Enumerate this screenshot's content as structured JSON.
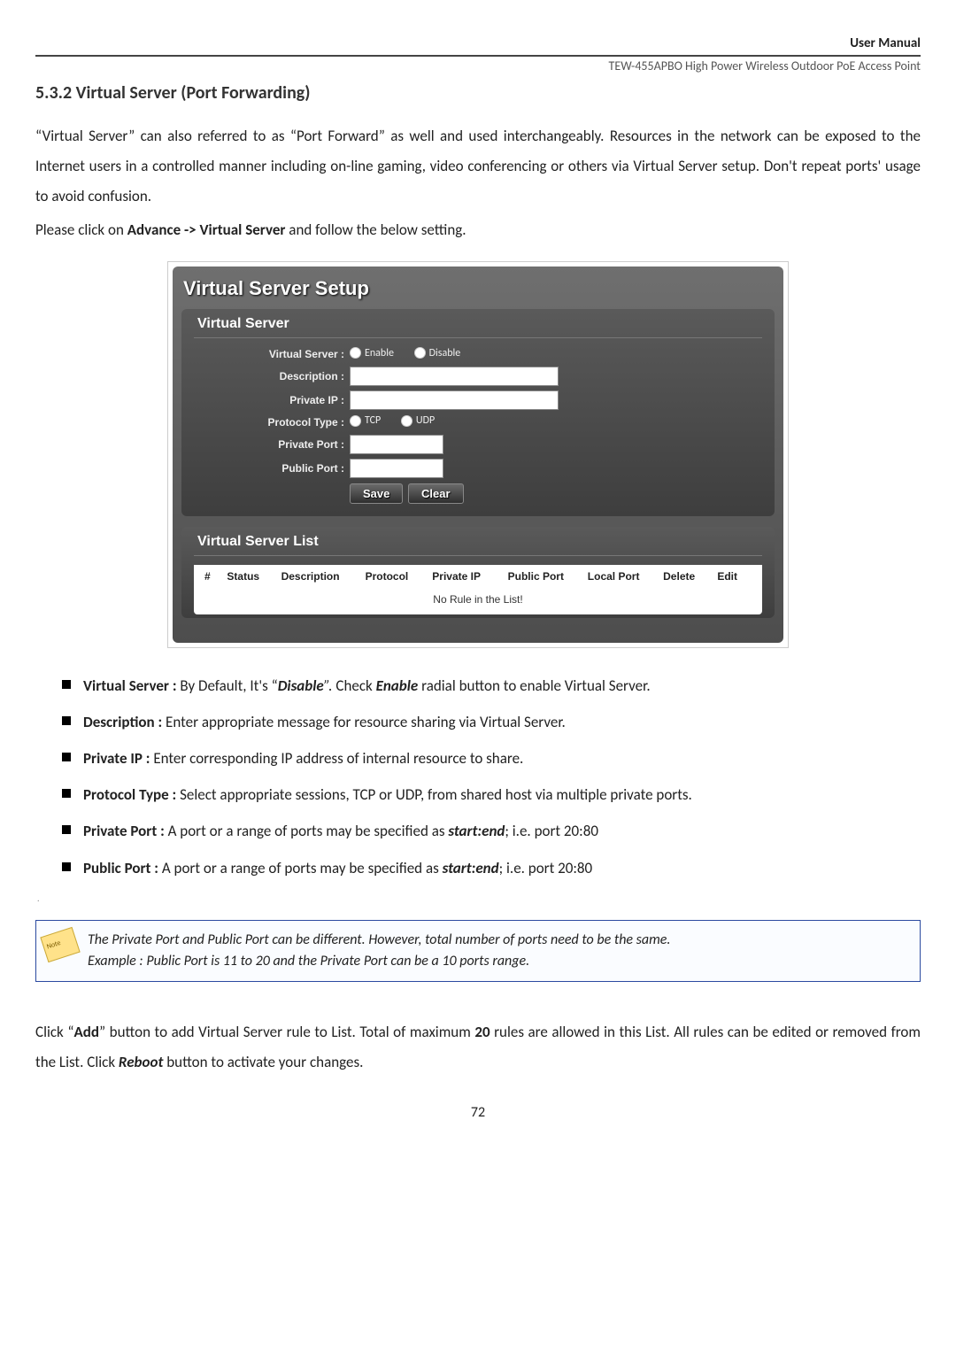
{
  "header": {
    "user_manual": "User Manual",
    "device": "TEW-455APBO High Power Wireless Outdoor PoE Access Point"
  },
  "section": {
    "heading": "5.3.2 Virtual Server (Port Forwarding)",
    "para1": "“Virtual Server” can also referred to as “Port Forward” as well and used interchangeably. Resources in the network can be exposed to the Internet users in a controlled manner including on-line gaming, video conferencing or others via Virtual Server setup.  Don't repeat ports' usage to avoid confusion.",
    "para2_pre": "Please click on ",
    "para2_bold": "Advance -> Virtual Server",
    "para2_post": " and follow the below setting."
  },
  "shot": {
    "title": "Virtual Server Setup",
    "panel1": {
      "header": "Virtual Server",
      "labels": {
        "vs": "Virtual Server :",
        "desc": "Description :",
        "pip": "Private IP :",
        "ptype": "Protocol Type :",
        "pport": "Private Port :",
        "pubport": "Public Port :"
      },
      "radios": {
        "enable": "Enable",
        "disable": "Disable",
        "tcp": "TCP",
        "udp": "UDP"
      },
      "buttons": {
        "save": "Save",
        "clear": "Clear"
      }
    },
    "panel2": {
      "header": "Virtual Server List",
      "cols": {
        "hash": "#",
        "status": "Status",
        "desc": "Description",
        "proto": "Protocol",
        "pip": "Private IP",
        "pubport": "Public Port",
        "lport": "Local Port",
        "del": "Delete",
        "edit": "Edit"
      },
      "empty": "No Rule in the List!"
    }
  },
  "bullets": {
    "b1_label": "Virtual Server : ",
    "b1_t1": "By Default, It's “",
    "b1_em1": "Disable",
    "b1_t2": "”. ",
    "b1_t3": "Check ",
    "b1_em2": "Enable",
    "b1_t4": " radial button to enable Virtual Server.",
    "b2_label": "Description : ",
    "b2_text": "Enter appropriate message for resource sharing via Virtual Server.",
    "b3_label": "Private IP : ",
    "b3_text": "Enter corresponding IP address of internal resource to share.",
    "b4_label": "Protocol Type : ",
    "b4_text": "Select appropriate sessions, TCP or UDP, from shared host via multiple private ports.",
    "b5_label": "Private Port : ",
    "b5_t1": "A port or a range of ports may be specified as ",
    "b5_em": "start:end",
    "b5_t2": "; i.e.  port 20:80",
    "b6_label": "Public Port : ",
    "b6_t1": "A port or a range of ports may be specified as ",
    "b6_em": "start:end",
    "b6_t2": "; i.e. port 20:80"
  },
  "note": {
    "line1": "The Private Port and Public Port can be different. However, total number of ports need to be the same.",
    "line2": "Example : Public Port is 11 to 20 and the Private Port can be a 10 ports range."
  },
  "closing": {
    "t1": "Click “",
    "add": "Add",
    "t2": "” button to add Virtual Server rule to List. Total of maximum ",
    "twenty": "20",
    "t3": " rules are allowed in this List. All rules can be edited or removed from the List. Click ",
    "reboot": "Reboot",
    "t4": " button to activate your changes."
  },
  "pagenum": "72"
}
